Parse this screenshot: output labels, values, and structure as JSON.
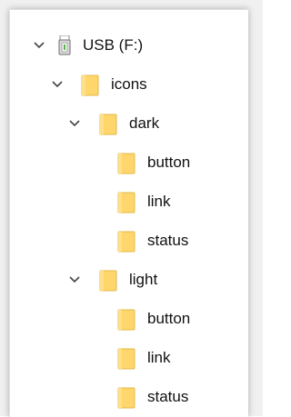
{
  "tree": {
    "root": {
      "label": "USB (F:)",
      "icon": "usb-drive-icon",
      "expanded": true
    },
    "icons": {
      "label": "icons",
      "icon": "folder-icon",
      "expanded": true
    },
    "dark": {
      "label": "dark",
      "icon": "folder-icon",
      "expanded": true,
      "children": [
        {
          "label": "button",
          "icon": "folder-icon"
        },
        {
          "label": "link",
          "icon": "folder-icon"
        },
        {
          "label": "status",
          "icon": "folder-icon"
        }
      ]
    },
    "light": {
      "label": "light",
      "icon": "folder-icon",
      "expanded": true,
      "children": [
        {
          "label": "button",
          "icon": "folder-icon"
        },
        {
          "label": "link",
          "icon": "folder-icon"
        },
        {
          "label": "status",
          "icon": "folder-icon"
        }
      ]
    }
  },
  "colors": {
    "folder_fill": "#ffd66b",
    "folder_edge": "#e0b84a",
    "chevron": "#444444",
    "text": "#111111"
  }
}
